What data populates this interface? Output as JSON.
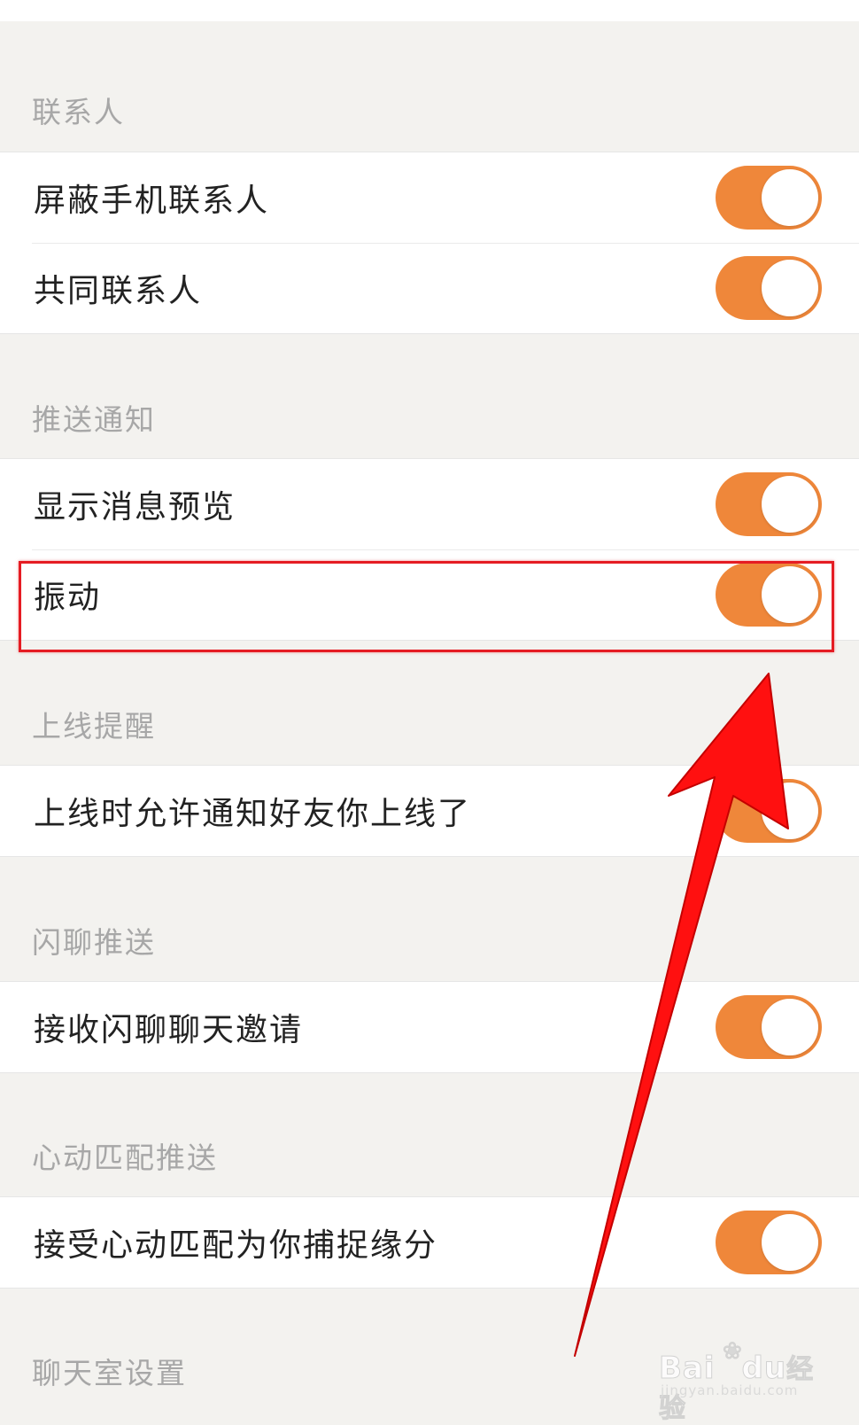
{
  "sections": [
    {
      "title": "联系人",
      "items": [
        {
          "label": "屏蔽手机联系人",
          "on": true
        },
        {
          "label": "共同联系人",
          "on": true
        }
      ]
    },
    {
      "title": "推送通知",
      "items": [
        {
          "label": "显示消息预览",
          "on": true
        },
        {
          "label": "振动",
          "on": true
        }
      ]
    },
    {
      "title": "上线提醒",
      "items": [
        {
          "label": "上线时允许通知好友你上线了",
          "on": true
        }
      ]
    },
    {
      "title": "闪聊推送",
      "items": [
        {
          "label": "接收闪聊聊天邀请",
          "on": true
        }
      ]
    },
    {
      "title": "心动匹配推送",
      "items": [
        {
          "label": "接受心动匹配为你捕捉缘分",
          "on": true
        }
      ]
    },
    {
      "title": "聊天室设置",
      "items": []
    }
  ],
  "colors": {
    "toggle_on": "#ef873a",
    "background": "#f3f2ef",
    "highlight": "#e51c23",
    "arrow": "#ff1010"
  },
  "watermark": {
    "brand": "Bai",
    "brand_suffix": "经验",
    "url": "jingyan.baidu.com"
  }
}
